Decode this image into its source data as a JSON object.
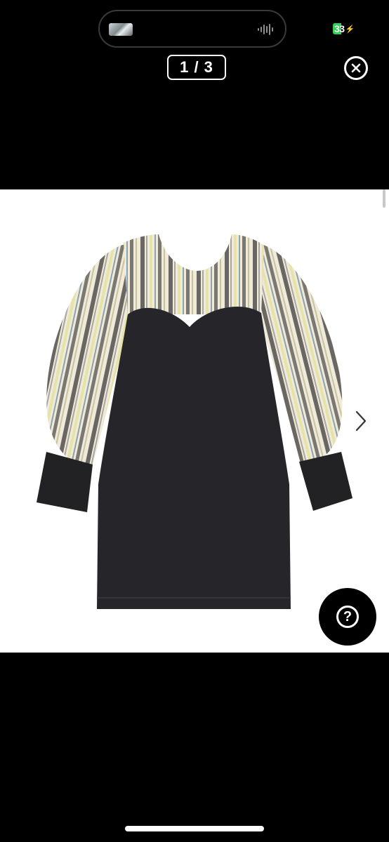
{
  "status_bar": {
    "battery_level": "33",
    "battery_color": "#30d158",
    "charging_icon": "bolt-icon",
    "island_icons": [
      "media-thumbnail",
      "audio-waveform-icon"
    ]
  },
  "viewer": {
    "counter": "1 / 3",
    "close_icon": "close-circle-icon",
    "next_icon": "chevron-right-icon",
    "help_icon": "question-mark-icon",
    "help_label": "?"
  }
}
